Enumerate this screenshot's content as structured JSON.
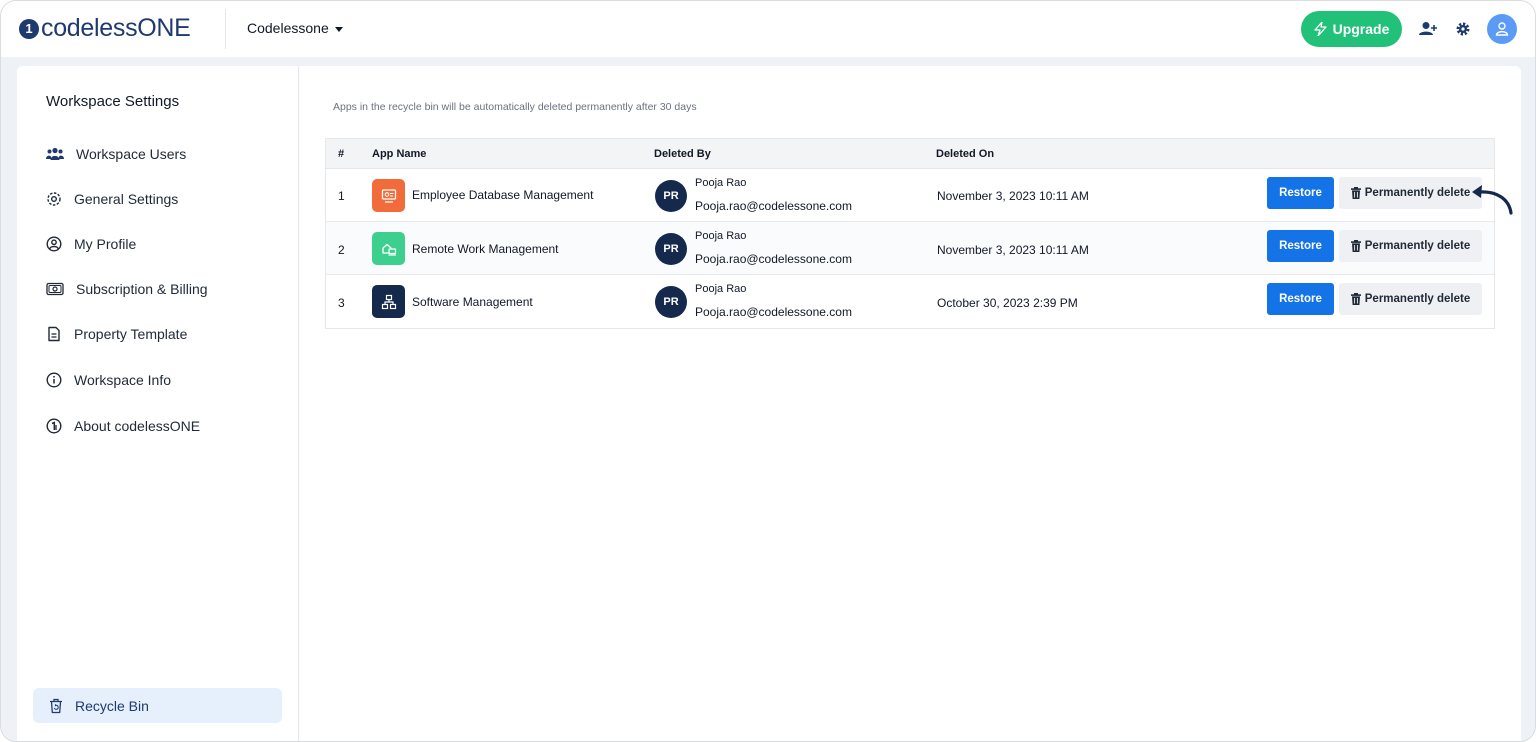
{
  "header": {
    "logo_mark": "1",
    "logo_text": "codelessONE",
    "workspace_name": "Codelessone",
    "upgrade_label": "Upgrade"
  },
  "sidebar": {
    "title": "Workspace Settings",
    "items": [
      {
        "label": "Workspace Users",
        "icon": "users-icon"
      },
      {
        "label": "General Settings",
        "icon": "gear-icon"
      },
      {
        "label": "My Profile",
        "icon": "user-circle-icon"
      },
      {
        "label": "Subscription & Billing",
        "icon": "billing-icon"
      },
      {
        "label": "Property Template",
        "icon": "document-icon"
      },
      {
        "label": "Workspace Info",
        "icon": "info-icon"
      },
      {
        "label": "About codelessONE",
        "icon": "codelessone-logo-icon"
      }
    ],
    "active_item": {
      "label": "Recycle Bin",
      "icon": "recycle-bin-icon"
    }
  },
  "main": {
    "notice": "Apps in the recycle bin will be automatically deleted permanently after 30 days",
    "table": {
      "columns": [
        "#",
        "App Name",
        "Deleted By",
        "Deleted On"
      ],
      "rows": [
        {
          "index": "1",
          "app_name": "Employee Database Management",
          "icon_color": "#f26b3a",
          "initials": "PR",
          "user_name": "Pooja Rao",
          "user_email": "Pooja.rao@codelessone.com",
          "deleted_on": "November 3, 2023 10:11 AM"
        },
        {
          "index": "2",
          "app_name": "Remote Work Management",
          "icon_color": "#3ccf8e",
          "initials": "PR",
          "user_name": "Pooja Rao",
          "user_email": "Pooja.rao@codelessone.com",
          "deleted_on": "November 3, 2023 10:11 AM"
        },
        {
          "index": "3",
          "app_name": "Software Management",
          "icon_color": "#15294d",
          "initials": "PR",
          "user_name": "Pooja Rao",
          "user_email": "Pooja.rao@codelessone.com",
          "deleted_on": "October 30, 2023 2:39 PM"
        }
      ],
      "restore_label": "Restore",
      "permanent_delete_label": "Permanently delete"
    }
  },
  "colors": {
    "brand_navy": "#1e3a6e",
    "upgrade_green": "#21c17a",
    "restore_blue": "#1473e6",
    "active_bg": "#e6effc"
  }
}
